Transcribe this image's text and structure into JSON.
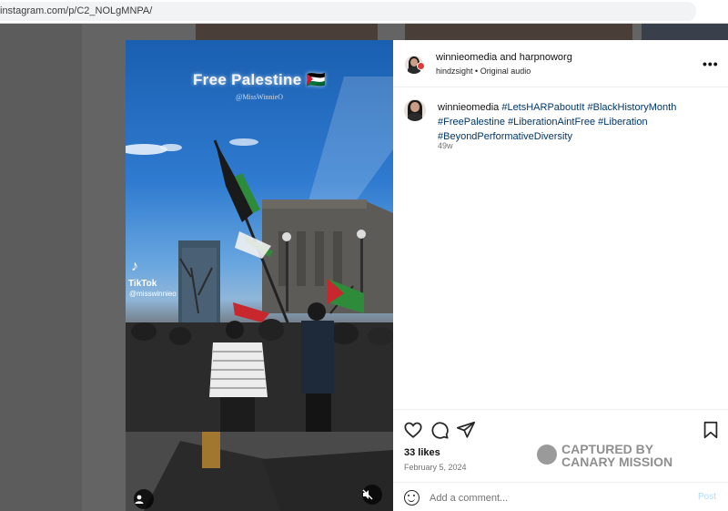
{
  "browser": {
    "url": "instagram.com/p/C2_NOLgMNPA/"
  },
  "video": {
    "overlay_title": "Free Palestine 🇵🇸",
    "overlay_handle": "@MissWinnieO",
    "tiktok_logo": "♪",
    "tiktok_label": "TikTok",
    "tiktok_handle": "@misswinnieo",
    "user_icon": "person-icon",
    "mute_icon": "muted-speaker-icon"
  },
  "post": {
    "header": {
      "author": "winnieomedia",
      "connector": " and ",
      "collaborator": "harpnoworg",
      "audio_user": "hindzsight",
      "audio_sep": " • ",
      "audio_label": "Original audio",
      "more": "•••"
    },
    "caption": {
      "user": "winnieomedia",
      "tags": [
        "#LetsHARPaboutIt",
        "#BlackHistoryMonth",
        "#FreePalestine",
        "#LiberationAintFree",
        "#Liberation",
        "#BeyondPerformativeDiversity"
      ],
      "time": "49w"
    },
    "actions": {
      "like_icon": "heart-icon",
      "comment_icon": "comment-icon",
      "share_icon": "send-icon",
      "save_icon": "bookmark-icon"
    },
    "likes": "33 likes",
    "date": "February 5, 2024",
    "comment": {
      "placeholder": "Add a comment...",
      "post_label": "Post"
    }
  },
  "watermark": {
    "line1": "CAPTURED BY",
    "line2": "CANARY MISSION"
  },
  "colors": {
    "hashtag": "#00376b",
    "post_disabled": "#b3dbff",
    "secondary_text": "#737373"
  }
}
